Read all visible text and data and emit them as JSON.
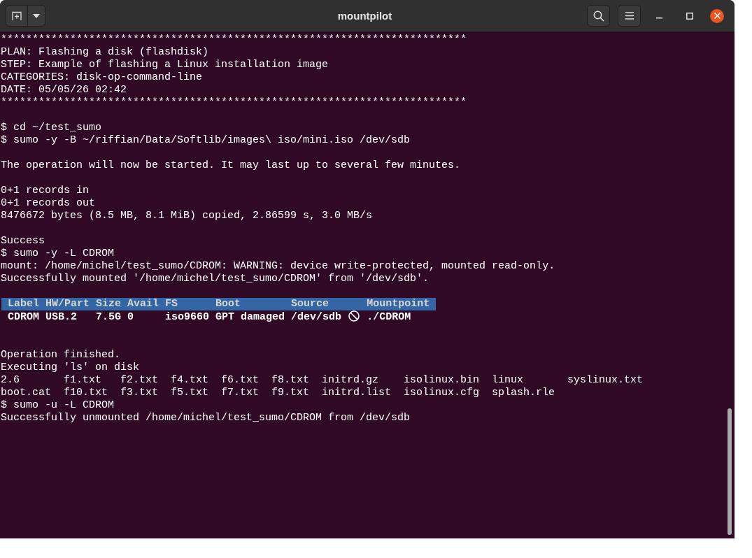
{
  "window": {
    "title": "mountpilot"
  },
  "terminal": {
    "items": [
      {
        "kind": "line",
        "text": "**************************************************************************"
      },
      {
        "kind": "line",
        "text": "PLAN: Flashing a disk (flashdisk)"
      },
      {
        "kind": "line",
        "text": "STEP: Example of flashing a Linux installation image"
      },
      {
        "kind": "line",
        "text": "CATEGORIES: disk-op-command-line"
      },
      {
        "kind": "line",
        "text": "DATE: 05/05/26 02:42"
      },
      {
        "kind": "line",
        "text": "**************************************************************************"
      },
      {
        "kind": "blank"
      },
      {
        "kind": "line",
        "text": "$ cd ~/test_sumo"
      },
      {
        "kind": "line",
        "text": "$ sumo -y -B ~/riffian/Data/Softlib/images\\ iso/mini.iso /dev/sdb"
      },
      {
        "kind": "blank"
      },
      {
        "kind": "line",
        "text": "The operation will now be started. It may last up to several few minutes."
      },
      {
        "kind": "blank"
      },
      {
        "kind": "line",
        "text": "0+1 records in"
      },
      {
        "kind": "line",
        "text": "0+1 records out"
      },
      {
        "kind": "line",
        "text": "8476672 bytes (8.5 MB, 8.1 MiB) copied, 2.86599 s, 3.0 MB/s"
      },
      {
        "kind": "blank"
      },
      {
        "kind": "line",
        "text": "Success"
      },
      {
        "kind": "line",
        "text": "$ sumo -y -L CDROM"
      },
      {
        "kind": "line",
        "text": "mount: /home/michel/test_sumo/CDROM: WARNING: device write-protected, mounted read-only."
      },
      {
        "kind": "line",
        "text": "Successfully mounted '/home/michel/test_sumo/CDROM' from '/dev/sdb'."
      },
      {
        "kind": "blank"
      },
      {
        "kind": "table",
        "columns": [
          "Label",
          "HW/Part",
          "Size",
          "Avail",
          "FS",
          "Boot",
          "Source",
          "Mountpoint"
        ],
        "rows": [
          {
            "label": "CDROM",
            "hw_part": "USB.2",
            "size": "7.5G",
            "avail": "0",
            "fs": "iso9660",
            "boot": "GPT damaged",
            "source": "/dev/sdb",
            "read_only": true,
            "mountpoint": "./CDROM"
          }
        ]
      },
      {
        "kind": "blank"
      },
      {
        "kind": "blank"
      },
      {
        "kind": "line",
        "text": "Operation finished."
      },
      {
        "kind": "line",
        "text": "Executing 'ls' on disk"
      },
      {
        "kind": "ls",
        "columns": [
          [
            "2.6",
            "boot.cat"
          ],
          [
            "f1.txt",
            "f10.txt"
          ],
          [
            "f2.txt",
            "f3.txt"
          ],
          [
            "f4.txt",
            "f5.txt"
          ],
          [
            "f6.txt",
            "f7.txt"
          ],
          [
            "f8.txt",
            "f9.txt"
          ],
          [
            "initrd.gz",
            "initrd.list"
          ],
          [
            "isolinux.bin",
            "isolinux.cfg"
          ],
          [
            "linux",
            "splash.rle"
          ],
          [
            "syslinux.txt"
          ]
        ]
      },
      {
        "kind": "line",
        "text": "$ sumo -u -L CDROM"
      },
      {
        "kind": "line",
        "text": "Successfully unmounted /home/michel/test_sumo/CDROM from /dev/sdb"
      }
    ]
  }
}
